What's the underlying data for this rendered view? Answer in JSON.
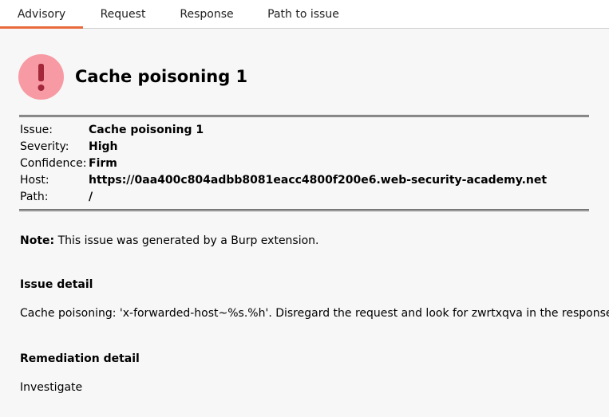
{
  "tabs": [
    {
      "label": "Advisory",
      "active": true
    },
    {
      "label": "Request",
      "active": false
    },
    {
      "label": "Response",
      "active": false
    },
    {
      "label": "Path to issue",
      "active": false
    }
  ],
  "accent_color": "#e8693a",
  "alert_icon": {
    "name": "exclamation-icon",
    "color": "#f79aa3",
    "mark_color": "#a3283a"
  },
  "header": {
    "title": "Cache poisoning 1"
  },
  "meta": {
    "issue": {
      "key": "Issue:",
      "value": "Cache poisoning 1"
    },
    "severity": {
      "key": "Severity:",
      "value": "High"
    },
    "confidence": {
      "key": "Confidence:",
      "value": "Firm"
    },
    "host": {
      "key": "Host:",
      "value": "https://0aa400c804adbb8081eacc4800f200e6.web-security-academy.net"
    },
    "path": {
      "key": "Path:",
      "value": "/"
    }
  },
  "note": {
    "label": "Note:",
    "text": " This issue was generated by a Burp extension."
  },
  "issue_detail": {
    "heading": "Issue detail",
    "text": "Cache poisoning: 'x-forwarded-host~%s.%h'. Disregard the request and look for zwrtxqva in the response"
  },
  "remediation_detail": {
    "heading": "Remediation detail",
    "text": "Investigate"
  }
}
